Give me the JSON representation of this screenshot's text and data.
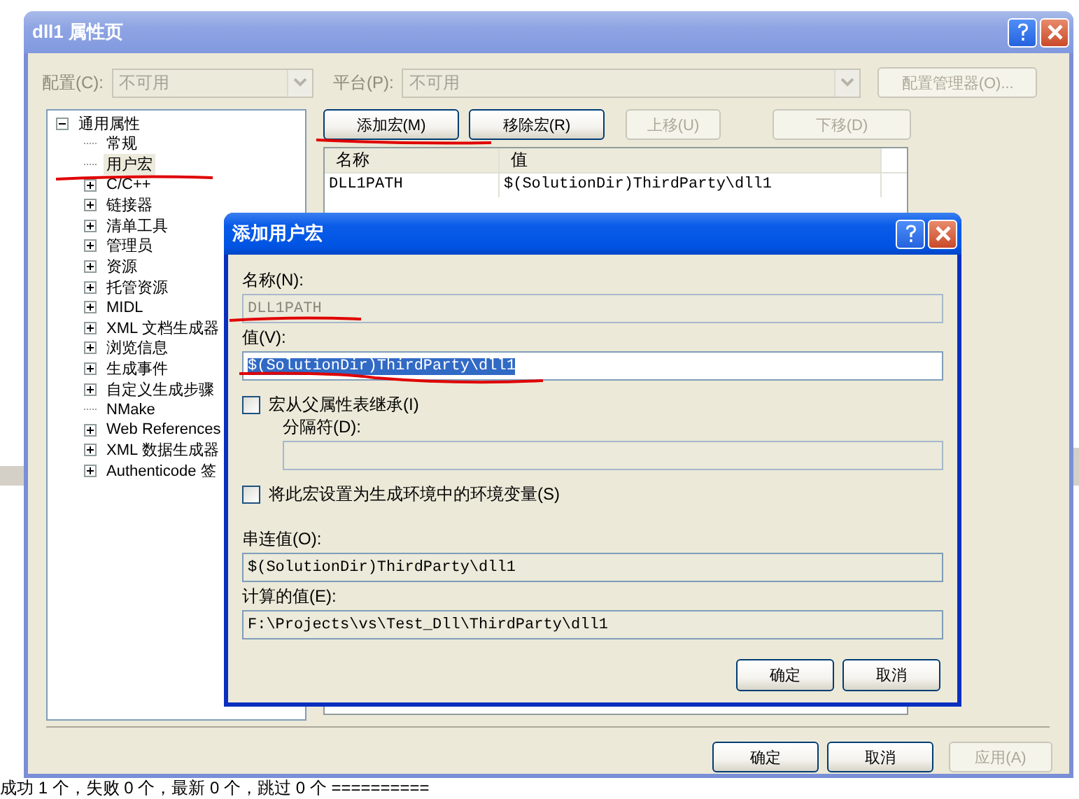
{
  "background": {
    "status_line": "成功 1 个，失败 0 个，最新 0 个，跳过 0 个 =========="
  },
  "main_window": {
    "title": "dll1 属性页",
    "config": {
      "label": "配置(C):",
      "value": "不可用",
      "disabled": true
    },
    "platform": {
      "label": "平台(P):",
      "value": "不可用",
      "disabled": true
    },
    "config_manager_button": {
      "label": "配置管理器(O)...",
      "disabled": true
    },
    "tree": [
      {
        "label": "通用属性",
        "kind": "group",
        "expanded": true,
        "selected": false,
        "children": [
          {
            "label": "常规",
            "kind": "leaf",
            "selected": false
          },
          {
            "label": "用户宏",
            "kind": "leaf",
            "selected": true
          },
          {
            "label": "C/C++",
            "kind": "group",
            "expanded": false,
            "selected": false
          },
          {
            "label": "链接器",
            "kind": "group",
            "expanded": false,
            "selected": false
          },
          {
            "label": "清单工具",
            "kind": "group",
            "expanded": false,
            "selected": false
          },
          {
            "label": "管理员",
            "kind": "group",
            "expanded": false,
            "selected": false
          },
          {
            "label": "资源",
            "kind": "group",
            "expanded": false,
            "selected": false
          },
          {
            "label": "托管资源",
            "kind": "group",
            "expanded": false,
            "selected": false
          },
          {
            "label": "MIDL",
            "kind": "group",
            "expanded": false,
            "selected": false
          },
          {
            "label": "XML 文档生成器",
            "kind": "group",
            "expanded": false,
            "selected": false
          },
          {
            "label": "浏览信息",
            "kind": "group",
            "expanded": false,
            "selected": false
          },
          {
            "label": "生成事件",
            "kind": "group",
            "expanded": false,
            "selected": false
          },
          {
            "label": "自定义生成步骤",
            "kind": "group",
            "expanded": false,
            "selected": false
          },
          {
            "label": "NMake",
            "kind": "leaf",
            "selected": false
          },
          {
            "label": "Web References",
            "kind": "group",
            "expanded": false,
            "selected": false
          },
          {
            "label": "XML 数据生成器",
            "kind": "group",
            "expanded": false,
            "selected": false
          },
          {
            "label": "Authenticode 签",
            "kind": "group",
            "expanded": false,
            "selected": false
          }
        ]
      }
    ],
    "toolbar_buttons": [
      {
        "label": "添加宏(M)",
        "disabled": false
      },
      {
        "label": "移除宏(R)",
        "disabled": false
      },
      {
        "label": "上移(U)",
        "disabled": true
      },
      {
        "label": "下移(D)",
        "disabled": true
      }
    ],
    "macro_grid": {
      "columns": [
        "名称",
        "值"
      ],
      "rows": [
        {
          "name": "DLL1PATH",
          "value": "$(SolutionDir)ThirdParty\\dll1"
        }
      ]
    },
    "footer_buttons": [
      {
        "label": "确定",
        "disabled": false
      },
      {
        "label": "取消",
        "disabled": false
      },
      {
        "label": "应用(A)",
        "disabled": true
      }
    ]
  },
  "dialog": {
    "title": "添加用户宏",
    "name": {
      "label": "名称(N):",
      "value": "DLL1PATH",
      "disabled": true
    },
    "value": {
      "label": "值(V):",
      "value": "$(SolutionDir)ThirdParty\\dll1",
      "selected": true
    },
    "inherit_checkbox": {
      "label": "宏从父属性表继承(I)",
      "checked": false
    },
    "separator": {
      "label": "分隔符(D):",
      "disabled": true
    },
    "env_checkbox": {
      "label": "将此宏设置为生成环境中的环境变量(S)",
      "checked": false
    },
    "concatenated": {
      "label": "串连值(O):",
      "value": "$(SolutionDir)ThirdParty\\dll1"
    },
    "evaluated": {
      "label": "计算的值(E):",
      "value": "F:\\Projects\\vs\\Test_Dll\\ThirdParty\\dll1"
    },
    "buttons": [
      {
        "label": "确定",
        "disabled": false
      },
      {
        "label": "取消",
        "disabled": false
      }
    ]
  }
}
